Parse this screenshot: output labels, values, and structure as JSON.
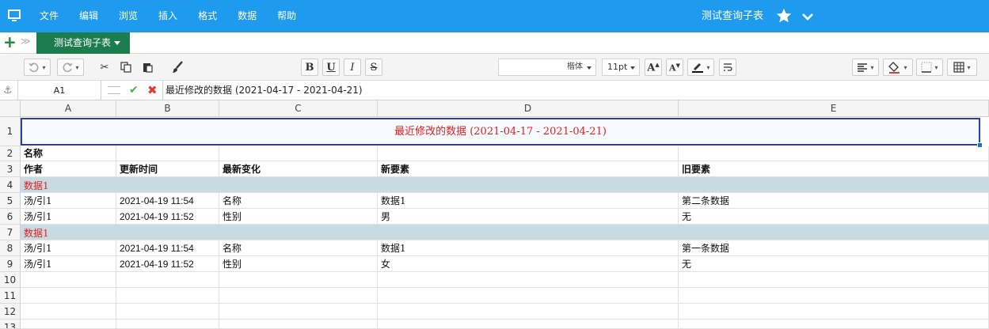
{
  "menubar": {
    "items": [
      "文件",
      "编辑",
      "浏览",
      "插入",
      "格式",
      "数据",
      "帮助"
    ],
    "doc_title": "测试查询子表",
    "color": "#1e9bef"
  },
  "tabbar": {
    "add_label": "+",
    "list_label": "≫",
    "active_sheet": "测试查询子表",
    "tab_color": "#1d7c4d"
  },
  "toolbar": {
    "bold": "B",
    "underline": "U",
    "italic": "I",
    "strike": "S",
    "font_name": "楷体",
    "font_size": "11pt"
  },
  "formula_bar": {
    "cell_ref": "A1",
    "content": "最近修改的数据 (2021-04-17 - 2021-04-21)"
  },
  "grid": {
    "columns": [
      "A",
      "B",
      "C",
      "D",
      "E"
    ],
    "rows": [
      "1",
      "2",
      "3",
      "4",
      "5",
      "6",
      "7",
      "8",
      "9",
      "10",
      "11",
      "12",
      "13"
    ],
    "title": "最近修改的数据 (2021-04-17 - 2021-04-21)",
    "row2_label": "名称",
    "headers": [
      "作者",
      "更新时间",
      "最新变化",
      "新要素",
      "旧要素"
    ],
    "group1": "数据1",
    "group1_rows": [
      [
        "汤/引1",
        "2021-04-19 11:54",
        "名称",
        "数据1",
        "第二条数据"
      ],
      [
        "汤/引1",
        "2021-04-19 11:52",
        "性别",
        "男",
        "无"
      ]
    ],
    "group2": "数据1",
    "group2_rows": [
      [
        "汤/引1",
        "2021-04-19 11:54",
        "名称",
        "数据1",
        "第一条数据"
      ],
      [
        "汤/引1",
        "2021-04-19 11:52",
        "性别",
        "女",
        "无"
      ]
    ],
    "accent_red": "#e02020",
    "band_color": "#c9dae1"
  }
}
